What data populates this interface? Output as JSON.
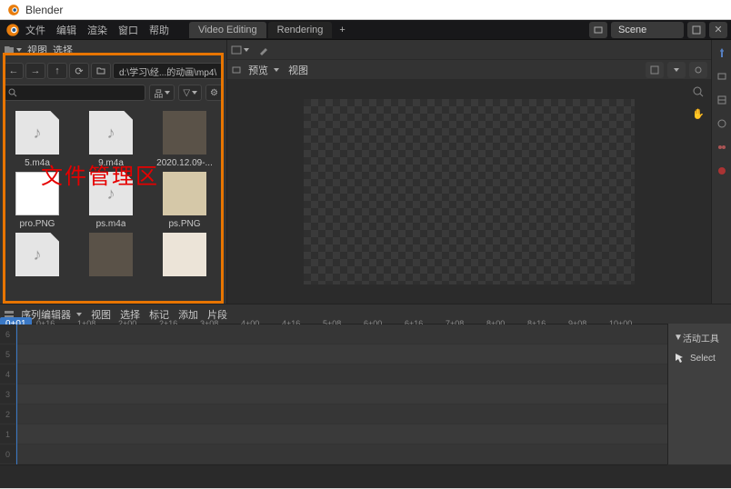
{
  "titlebar": {
    "app_name": "Blender"
  },
  "topmenu": {
    "file": "文件",
    "edit": "编辑",
    "render": "渲染",
    "window": "窗口",
    "help": "帮助"
  },
  "workspace_tabs": {
    "video_editing": "Video Editing",
    "rendering": "Rendering",
    "add": "+"
  },
  "scene": {
    "label": "Scene"
  },
  "filebrowser": {
    "view_menu": "视图",
    "select_menu": "选择",
    "path": "d:\\学习\\经...的动画\\mp4\\",
    "display_mode": "品",
    "filter": "▽",
    "annotation": "文件管理区",
    "files": [
      {
        "name": "5.m4a",
        "type": "doc"
      },
      {
        "name": "9.m4a",
        "type": "doc"
      },
      {
        "name": "2020.12.09-...",
        "type": "img"
      },
      {
        "name": "pro.PNG",
        "type": "img3"
      },
      {
        "name": "ps.m4a",
        "type": "doc"
      },
      {
        "name": "ps.PNG",
        "type": "img2"
      },
      {
        "name": "",
        "type": "doc"
      },
      {
        "name": "",
        "type": "img"
      },
      {
        "name": "",
        "type": "img4"
      }
    ]
  },
  "preview": {
    "preview_menu": "预览",
    "view_menu": "视图"
  },
  "sequencer": {
    "label": "序列编辑器",
    "view": "视图",
    "select": "选择",
    "marker": "标记",
    "add": "添加",
    "strip": "片段",
    "start_frame": "0+01",
    "ticks": [
      "0+16",
      "1+08",
      "2+00",
      "2+16",
      "3+08",
      "4+00",
      "4+16",
      "5+08",
      "6+00",
      "6+16",
      "7+08",
      "8+00",
      "8+16",
      "9+08",
      "10+00"
    ],
    "tracks": [
      "6",
      "5",
      "4",
      "3",
      "2",
      "1",
      "0"
    ],
    "sidebar_header": "活动工具",
    "tool_select": "Select"
  }
}
